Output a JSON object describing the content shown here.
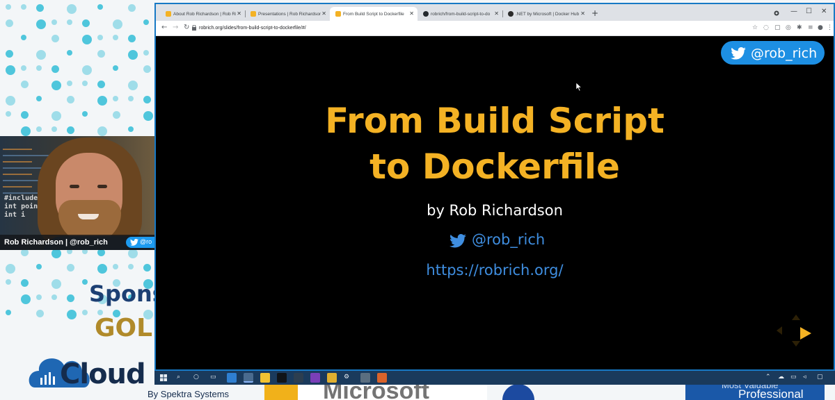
{
  "browser": {
    "tabs": [
      {
        "title": "About Rob Richardson | Rob Ric",
        "favicon_color": "#f4b224"
      },
      {
        "title": "Presentations | Rob Richardson |",
        "favicon_color": "#f4b224"
      },
      {
        "title": "From Build Script to Dockerfile",
        "favicon_color": "#f4b224",
        "active": true
      },
      {
        "title": "robrich/from-build-script-to-do",
        "favicon_color": "#24292e"
      },
      {
        "title": ".NET by Microsoft | Docker Hub",
        "favicon_color": "#2b2b2b"
      }
    ],
    "close_glyph": "✕",
    "new_tab_glyph": "+",
    "url": "robrich.org/slides/from-build-script-to-dockerfile/#/",
    "window_controls": {
      "minimize": "—",
      "maximize": "☐",
      "close": "✕"
    }
  },
  "slide": {
    "twitter_pill": "@rob_rich",
    "title_line1": "From Build Script",
    "title_line2": "to Dockerfile",
    "author": "by Rob Richardson",
    "twitter_handle": "@rob_rich",
    "site_url": "https://robrich.org/"
  },
  "webcam": {
    "name_label": "Rob Richardson | @rob_rich",
    "twitter_fragment": "@ro",
    "code_text": "#include <std\nint pointint\nint i"
  },
  "stream_overlay": {
    "sponsor_text": "Spons",
    "gold_text": "GOL",
    "cloud_text": "Cloud",
    "cloud_byline": "By Spektra Systems",
    "ms_text": "Microsoft",
    "mvp_line1": "Most Valuable",
    "mvp_line2": "Professional"
  },
  "colors": {
    "slide_title": "#f4b224",
    "twitter_blue": "#1d8fe3",
    "link_blue": "#3f8ee0",
    "window_border": "#1779c5",
    "taskbar": "#1a3a5c"
  }
}
